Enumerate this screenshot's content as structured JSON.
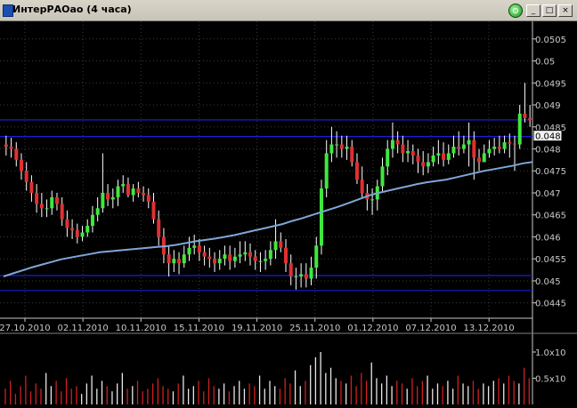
{
  "window": {
    "title": "ИнтерРАОао (4 часа)",
    "buttons": [
      "_",
      "□",
      "×"
    ]
  },
  "chart_data": {
    "type": "candlestick",
    "ylim": [
      0.04415,
      0.0509
    ],
    "y_ticks": [
      "0.0505",
      "0.05",
      "0.0495",
      "0.049",
      "0.0485",
      "0.048",
      "0.0475",
      "0.047",
      "0.0465",
      "0.046",
      "0.0455",
      "0.045",
      "0.0445"
    ],
    "last_price_label": "0.0483",
    "x_tick_labels": [
      "27.10.2010",
      "02.11.2010",
      "10.11.2010",
      "15.11.2010",
      "19.11.2010",
      "25.11.2010",
      "01.12.2010",
      "07.12.2010",
      "13.12.2010"
    ],
    "horizontal_levels": [
      0.04866,
      0.04828,
      0.04512,
      0.04478
    ],
    "candles": {
      "open": [
        0.0481,
        0.04805,
        0.048,
        0.04775,
        0.0475,
        0.04725,
        0.047,
        0.04675,
        0.04665,
        0.04665,
        0.0469,
        0.04675,
        0.0464,
        0.0462,
        0.04615,
        0.046,
        0.0461,
        0.04625,
        0.0465,
        0.04665,
        0.047,
        0.04685,
        0.0469,
        0.04715,
        0.0472,
        0.04695,
        0.0471,
        0.047,
        0.04695,
        0.0468,
        0.0464,
        0.046,
        0.0456,
        0.0454,
        0.0455,
        0.0454,
        0.0456,
        0.04575,
        0.0458,
        0.04565,
        0.04555,
        0.0455,
        0.0454,
        0.0455,
        0.0456,
        0.04545,
        0.04555,
        0.0456,
        0.04565,
        0.04555,
        0.04545,
        0.04545,
        0.0455,
        0.0457,
        0.0459,
        0.04575,
        0.0454,
        0.0451,
        0.0451,
        0.04515,
        0.04505,
        0.0453,
        0.0458,
        0.0471,
        0.0479,
        0.0481,
        0.0481,
        0.048,
        0.04805,
        0.0477,
        0.0473,
        0.047,
        0.04685,
        0.04685,
        0.04715,
        0.0476,
        0.048,
        0.0482,
        0.0481,
        0.0479,
        0.04795,
        0.04785,
        0.0477,
        0.0476,
        0.0477,
        0.04785,
        0.0479,
        0.04775,
        0.0479,
        0.04805,
        0.048,
        0.0481,
        0.0482,
        0.0478,
        0.0477,
        0.0479,
        0.048,
        0.04805,
        0.048,
        0.04815,
        0.04812,
        0.0481,
        0.0488,
        0.0487
      ],
      "close": [
        0.04805,
        0.048,
        0.04775,
        0.0475,
        0.04725,
        0.047,
        0.04675,
        0.04665,
        0.04665,
        0.0469,
        0.04675,
        0.0464,
        0.0462,
        0.04615,
        0.046,
        0.0461,
        0.04625,
        0.0465,
        0.04665,
        0.047,
        0.04685,
        0.0469,
        0.04715,
        0.0472,
        0.04695,
        0.0471,
        0.047,
        0.04695,
        0.0468,
        0.0464,
        0.046,
        0.0456,
        0.0454,
        0.0455,
        0.0454,
        0.0456,
        0.04575,
        0.0458,
        0.04565,
        0.04555,
        0.0455,
        0.0454,
        0.0455,
        0.0456,
        0.04545,
        0.04555,
        0.0456,
        0.04565,
        0.04555,
        0.04545,
        0.04545,
        0.0455,
        0.0457,
        0.0459,
        0.04575,
        0.0454,
        0.0451,
        0.0451,
        0.04515,
        0.04505,
        0.0453,
        0.0458,
        0.0471,
        0.0479,
        0.0481,
        0.0481,
        0.048,
        0.04805,
        0.0477,
        0.0473,
        0.047,
        0.04685,
        0.04685,
        0.04715,
        0.0476,
        0.048,
        0.0482,
        0.0481,
        0.0479,
        0.04795,
        0.04785,
        0.0477,
        0.0476,
        0.0477,
        0.04785,
        0.0479,
        0.04775,
        0.0479,
        0.04805,
        0.048,
        0.0481,
        0.0482,
        0.0478,
        0.0477,
        0.0479,
        0.048,
        0.04805,
        0.048,
        0.04815,
        0.04812,
        0.0481,
        0.0488,
        0.0487,
        0.04865
      ],
      "high": [
        0.0483,
        0.04825,
        0.04815,
        0.0479,
        0.0477,
        0.0474,
        0.0472,
        0.047,
        0.04685,
        0.04705,
        0.047,
        0.0469,
        0.0466,
        0.0464,
        0.0463,
        0.04625,
        0.0464,
        0.0467,
        0.0469,
        0.0479,
        0.0472,
        0.0471,
        0.0473,
        0.0474,
        0.04735,
        0.0472,
        0.04725,
        0.04715,
        0.0471,
        0.047,
        0.0466,
        0.0462,
        0.0458,
        0.0457,
        0.04565,
        0.0458,
        0.046,
        0.04605,
        0.04595,
        0.0458,
        0.04575,
        0.04565,
        0.0457,
        0.0458,
        0.0458,
        0.04575,
        0.0459,
        0.0459,
        0.04585,
        0.0457,
        0.04565,
        0.0457,
        0.0459,
        0.0464,
        0.0461,
        0.04595,
        0.0456,
        0.0453,
        0.0454,
        0.0454,
        0.04555,
        0.046,
        0.0473,
        0.0482,
        0.0485,
        0.0484,
        0.0483,
        0.0483,
        0.0482,
        0.0479,
        0.0476,
        0.0472,
        0.0471,
        0.0473,
        0.0478,
        0.0482,
        0.0486,
        0.0484,
        0.0483,
        0.0482,
        0.0481,
        0.048,
        0.04795,
        0.0479,
        0.04805,
        0.0482,
        0.04815,
        0.0481,
        0.0483,
        0.0484,
        0.0483,
        0.0486,
        0.0484,
        0.048,
        0.0481,
        0.0482,
        0.04825,
        0.0483,
        0.0483,
        0.04835,
        0.0483,
        0.049,
        0.0495,
        0.049
      ],
      "low": [
        0.04785,
        0.0478,
        0.0476,
        0.0473,
        0.04705,
        0.0468,
        0.04655,
        0.04645,
        0.04645,
        0.0465,
        0.0466,
        0.04625,
        0.046,
        0.04595,
        0.04585,
        0.0459,
        0.046,
        0.0461,
        0.04635,
        0.04655,
        0.0467,
        0.04665,
        0.0467,
        0.047,
        0.0469,
        0.0468,
        0.0469,
        0.0468,
        0.04665,
        0.0463,
        0.0458,
        0.0454,
        0.0451,
        0.0452,
        0.04515,
        0.0453,
        0.04545,
        0.0456,
        0.04545,
        0.04535,
        0.0453,
        0.0452,
        0.04525,
        0.04535,
        0.04525,
        0.0453,
        0.0454,
        0.04545,
        0.04535,
        0.04525,
        0.0452,
        0.04525,
        0.04535,
        0.0455,
        0.04565,
        0.0452,
        0.0449,
        0.0448,
        0.04485,
        0.04485,
        0.0449,
        0.04505,
        0.0456,
        0.0469,
        0.0477,
        0.0478,
        0.0478,
        0.04775,
        0.0476,
        0.0472,
        0.0469,
        0.0466,
        0.0465,
        0.0466,
        0.047,
        0.0474,
        0.0478,
        0.0479,
        0.0477,
        0.0477,
        0.04765,
        0.04745,
        0.0474,
        0.04745,
        0.0476,
        0.04765,
        0.0476,
        0.04765,
        0.0478,
        0.04785,
        0.0479,
        0.0476,
        0.0473,
        0.0475,
        0.0477,
        0.0478,
        0.04785,
        0.0479,
        0.0479,
        0.0478,
        0.0475,
        0.048,
        0.0486,
        0.0485
      ]
    },
    "moving_average": {
      "color": "#7fa6d8",
      "values": [
        0.0451,
        0.04517,
        0.04524,
        0.04531,
        0.04537,
        0.04543,
        0.04549,
        0.04553,
        0.04557,
        0.04561,
        0.04565,
        0.04567,
        0.04569,
        0.04571,
        0.04573,
        0.04575,
        0.04577,
        0.04579,
        0.04582,
        0.04586,
        0.0459,
        0.04593,
        0.04596,
        0.046,
        0.04604,
        0.04609,
        0.04614,
        0.04619,
        0.04624,
        0.04629,
        0.04636,
        0.04642,
        0.04649,
        0.04656,
        0.04663,
        0.0467,
        0.04678,
        0.04686,
        0.04694,
        0.047,
        0.04705,
        0.0471,
        0.04715,
        0.0472,
        0.04724,
        0.04727,
        0.0473,
        0.04735,
        0.0474,
        0.04745,
        0.0475,
        0.04754,
        0.04758,
        0.04762,
        0.04767,
        0.0477
      ]
    },
    "volume": {
      "y_ticks": [
        "1.0x10",
        "0.5x10"
      ],
      "values": [
        0.3,
        0.45,
        0.2,
        0.35,
        0.55,
        0.25,
        0.4,
        0.3,
        0.6,
        0.35,
        0.45,
        0.25,
        0.5,
        0.3,
        0.35,
        0.2,
        0.4,
        0.55,
        0.3,
        0.45,
        0.35,
        0.25,
        0.4,
        0.6,
        0.3,
        0.35,
        0.45,
        0.25,
        0.3,
        0.4,
        0.5,
        0.35,
        0.3,
        0.25,
        0.4,
        0.55,
        0.3,
        0.35,
        0.45,
        0.25,
        0.5,
        0.35,
        0.3,
        0.4,
        0.25,
        0.35,
        0.45,
        0.3,
        0.4,
        0.35,
        0.55,
        0.3,
        0.45,
        0.35,
        0.3,
        0.5,
        0.4,
        0.65,
        0.35,
        0.45,
        0.75,
        0.9,
        1.0,
        0.6,
        0.7,
        0.5,
        0.45,
        0.4,
        0.55,
        0.35,
        0.6,
        0.45,
        0.8,
        0.5,
        0.4,
        0.55,
        0.35,
        0.45,
        0.4,
        0.3,
        0.5,
        0.35,
        0.45,
        0.55,
        0.3,
        0.4,
        0.35,
        0.45,
        0.3,
        0.55,
        0.4,
        0.35,
        0.45,
        0.3,
        0.4,
        0.35,
        0.45,
        0.5,
        0.4,
        0.55,
        0.45,
        0.4,
        0.7,
        0.5
      ]
    }
  }
}
